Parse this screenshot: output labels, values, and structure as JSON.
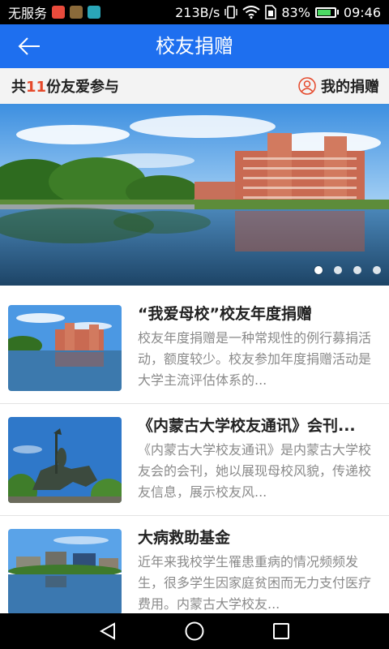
{
  "status_bar": {
    "carrier": "无服务",
    "speed": "213B/s",
    "battery_percent": "83%",
    "battery_level": 0.83,
    "time": "09:46"
  },
  "app_bar": {
    "title": "校友捐赠",
    "back_icon": "back-arrow-icon"
  },
  "summary": {
    "prefix": "共",
    "count": "11",
    "suffix": "份友爱参与",
    "my_donation_label": "我的捐赠",
    "my_donation_icon": "user-icon"
  },
  "banner": {
    "slide_count": 4,
    "active_index": 0
  },
  "news": [
    {
      "title": "“我爱母校”校友年度捐赠",
      "desc": "校友年度捐赠是一种常规性的例行募捐活动，额度较少。校友参加年度捐赠活动是大学主流评估体系的..."
    },
    {
      "title": "《内蒙古大学校友通讯》会刊...",
      "desc": "《内蒙古大学校友通讯》是内蒙古大学校友会的会刊，她以展现母校风貌，传递校友信息，展示校友风..."
    },
    {
      "title": "大病救助基金",
      "desc": "近年来我校学生罹患重病的情况频频发生，很多学生因家庭贫困而无力支付医疗费用。内蒙古大学校友..."
    }
  ],
  "colors": {
    "app_bar": "#1e6fef",
    "count_highlight": "#e5492b",
    "icon_accent": "#e5492b"
  }
}
